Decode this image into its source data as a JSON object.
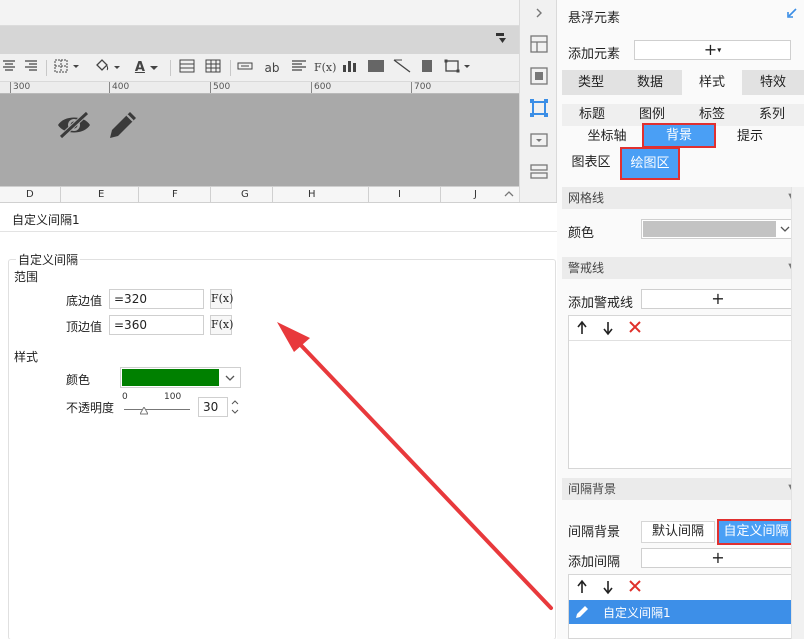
{
  "toolbar": {
    "font_color_letter": "A",
    "abc_label": "ab",
    "fx_label": "F(x)"
  },
  "ruler": {
    "labels": [
      "300",
      "400",
      "500",
      "600",
      "700"
    ]
  },
  "columns": [
    "D",
    "E",
    "F",
    "G",
    "H",
    "I",
    "J"
  ],
  "dialog": {
    "title": "自定义间隔1",
    "group_legend": "自定义间隔",
    "range_label": "范围",
    "bottom_label": "底边值",
    "bottom_value": "=320",
    "top_label": "顶边值",
    "top_value": "=360",
    "fx_label": "F(x)",
    "style_label": "样式",
    "color_label": "颜色",
    "color_value": "#008000",
    "opacity_label": "不透明度",
    "slider_min": "0",
    "slider_max": "100",
    "opacity_value": "30",
    "opacity_fraction": 0.3
  },
  "panel": {
    "title": "悬浮元素",
    "add_element_label": "添加元素",
    "add_element_button": "+",
    "main_tabs": [
      "类型",
      "数据",
      "样式",
      "特效"
    ],
    "main_tab_active": "样式",
    "sub_tabs_row1": [
      "标题",
      "图例",
      "标签",
      "系列"
    ],
    "sub_tabs_row2": [
      "坐标轴",
      "背景",
      "提示"
    ],
    "sub_tab_active": "背景",
    "area_tabs": [
      "图表区",
      "绘图区"
    ],
    "area_tab_active": "绘图区",
    "gridline_section": "网格线",
    "gridline_color_label": "颜色",
    "warning_section": "警戒线",
    "add_warning_label": "添加警戒线",
    "add_warning_button": "+",
    "interval_section": "间隔背景",
    "interval_bg_label": "间隔背景",
    "interval_options": [
      "默认间隔",
      "自定义间隔"
    ],
    "interval_active": "自定义间隔",
    "add_interval_label": "添加间隔",
    "add_interval_button": "+",
    "interval_items": [
      "自定义间隔1"
    ]
  },
  "colors": {
    "accent": "#4a9ff5",
    "highlight_border": "#e03030",
    "arrow": "#e8393c",
    "selected_row": "#3d8fe8",
    "delete_red": "#e0302a"
  }
}
